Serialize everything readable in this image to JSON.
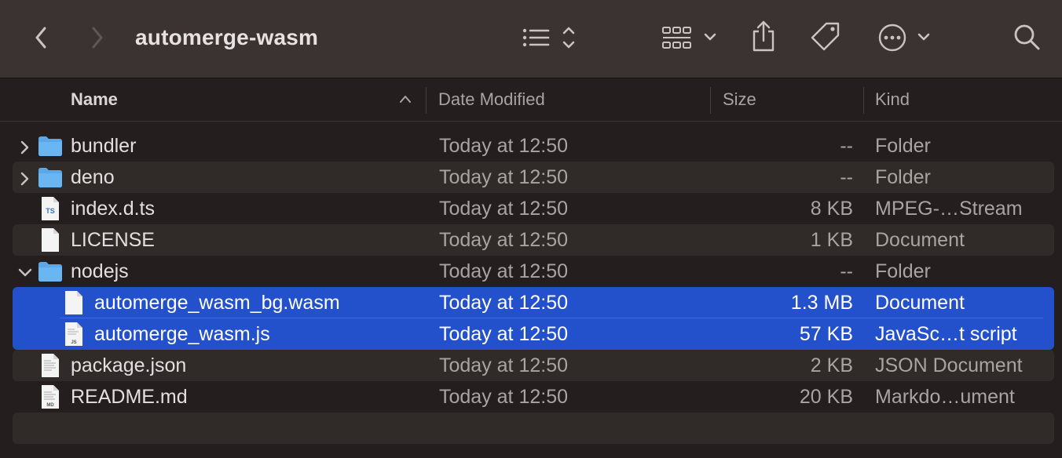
{
  "window": {
    "title": "automerge-wasm"
  },
  "toolbar": {
    "icons": [
      "back-icon",
      "forward-icon",
      "list-view-icon",
      "group-icon",
      "share-icon",
      "tag-icon",
      "more-icon",
      "search-icon"
    ]
  },
  "columns": {
    "name": "Name",
    "date": "Date Modified",
    "size": "Size",
    "kind": "Kind"
  },
  "files": [
    {
      "name": "bundler",
      "date": "Today at 12:50",
      "size": "--",
      "kind": "Folder",
      "type": "folder",
      "disclosure": "collapsed"
    },
    {
      "name": "deno",
      "date": "Today at 12:50",
      "size": "--",
      "kind": "Folder",
      "type": "folder",
      "disclosure": "collapsed"
    },
    {
      "name": "index.d.ts",
      "date": "Today at 12:50",
      "size": "8 KB",
      "kind": "MPEG-…Stream",
      "type": "ts-file",
      "badge": "TS"
    },
    {
      "name": "LICENSE",
      "date": "Today at 12:50",
      "size": "1 KB",
      "kind": "Document",
      "type": "document"
    },
    {
      "name": "nodejs",
      "date": "Today at 12:50",
      "size": "--",
      "kind": "Folder",
      "type": "folder",
      "disclosure": "expanded"
    },
    {
      "name": "automerge_wasm_bg.wasm",
      "date": "Today at 12:50",
      "size": "1.3 MB",
      "kind": "Document",
      "type": "document",
      "selected": true,
      "nested": true
    },
    {
      "name": "automerge_wasm.js",
      "date": "Today at 12:50",
      "size": "57 KB",
      "kind": "JavaSc…t script",
      "type": "js-file",
      "badge": "JS",
      "selected": true,
      "nested": true
    },
    {
      "name": "package.json",
      "date": "Today at 12:50",
      "size": "2 KB",
      "kind": "JSON Document",
      "type": "text-file"
    },
    {
      "name": "README.md",
      "date": "Today at 12:50",
      "size": "20 KB",
      "kind": "Markdo…ument",
      "type": "md-file",
      "badge": "MD"
    }
  ],
  "colors": {
    "selection": "#2350cb",
    "folder": "#5ba8e8",
    "window_bg": "#251e1e",
    "toolbar_bg": "#3a3332"
  }
}
